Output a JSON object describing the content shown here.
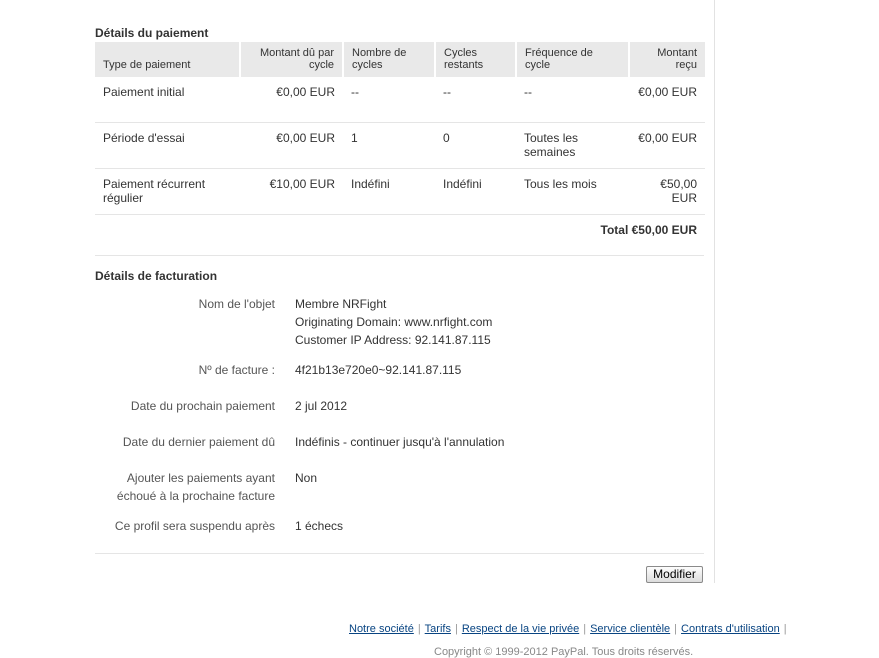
{
  "payment_details": {
    "title": "Détails du paiement",
    "headers": {
      "type": "Type de paiement",
      "amount_due": "Montant dû par cycle",
      "num_cycles": "Nombre de cycles",
      "remaining": "Cycles restants",
      "frequency": "Fréquence de cycle",
      "received": "Montant reçu"
    },
    "rows": [
      {
        "type": "Paiement initial",
        "amount_due": "€0,00 EUR",
        "num_cycles": "--",
        "remaining": "--",
        "frequency": "--",
        "received": "€0,00 EUR"
      },
      {
        "type": "Période d'essai",
        "amount_due": "€0,00 EUR",
        "num_cycles": "1",
        "remaining": "0",
        "frequency": "Toutes les semaines",
        "received": "€0,00 EUR"
      },
      {
        "type": "Paiement récurrent régulier",
        "amount_due": "€10,00 EUR",
        "num_cycles": "Indéfini",
        "remaining": "Indéfini",
        "frequency": "Tous les mois",
        "received": "€50,00 EUR"
      }
    ],
    "total": "Total €50,00 EUR"
  },
  "billing_details": {
    "title": "Détails de facturation",
    "item_name_label": "Nom de l'objet",
    "item_name_lines": [
      "Membre NRFight",
      "Originating Domain: www.nrfight.com",
      "Customer IP Address: 92.141.87.115"
    ],
    "invoice_label": "Nº de facture :",
    "invoice_value": "4f21b13e720e0~92.141.87.115",
    "next_payment_label": "Date du prochain paiement",
    "next_payment_value": "2 jul 2012",
    "last_payment_label": "Date du dernier paiement dû",
    "last_payment_value": "Indéfinis - continuer jusqu'à l'annulation",
    "add_failed_label": "Ajouter les paiements ayant échoué à la prochaine facture",
    "add_failed_value": "Non",
    "suspend_label": "Ce profil sera suspendu après",
    "suspend_value": "1 échecs"
  },
  "actions": {
    "modify_label": "Modifier"
  },
  "footer": {
    "links": [
      "Notre société",
      "Tarifs",
      "Respect de la vie privée",
      "Service clientèle",
      "Contrats d'utilisation"
    ],
    "copyright": "Copyright © 1999-2012 PayPal. Tous droits réservés."
  }
}
